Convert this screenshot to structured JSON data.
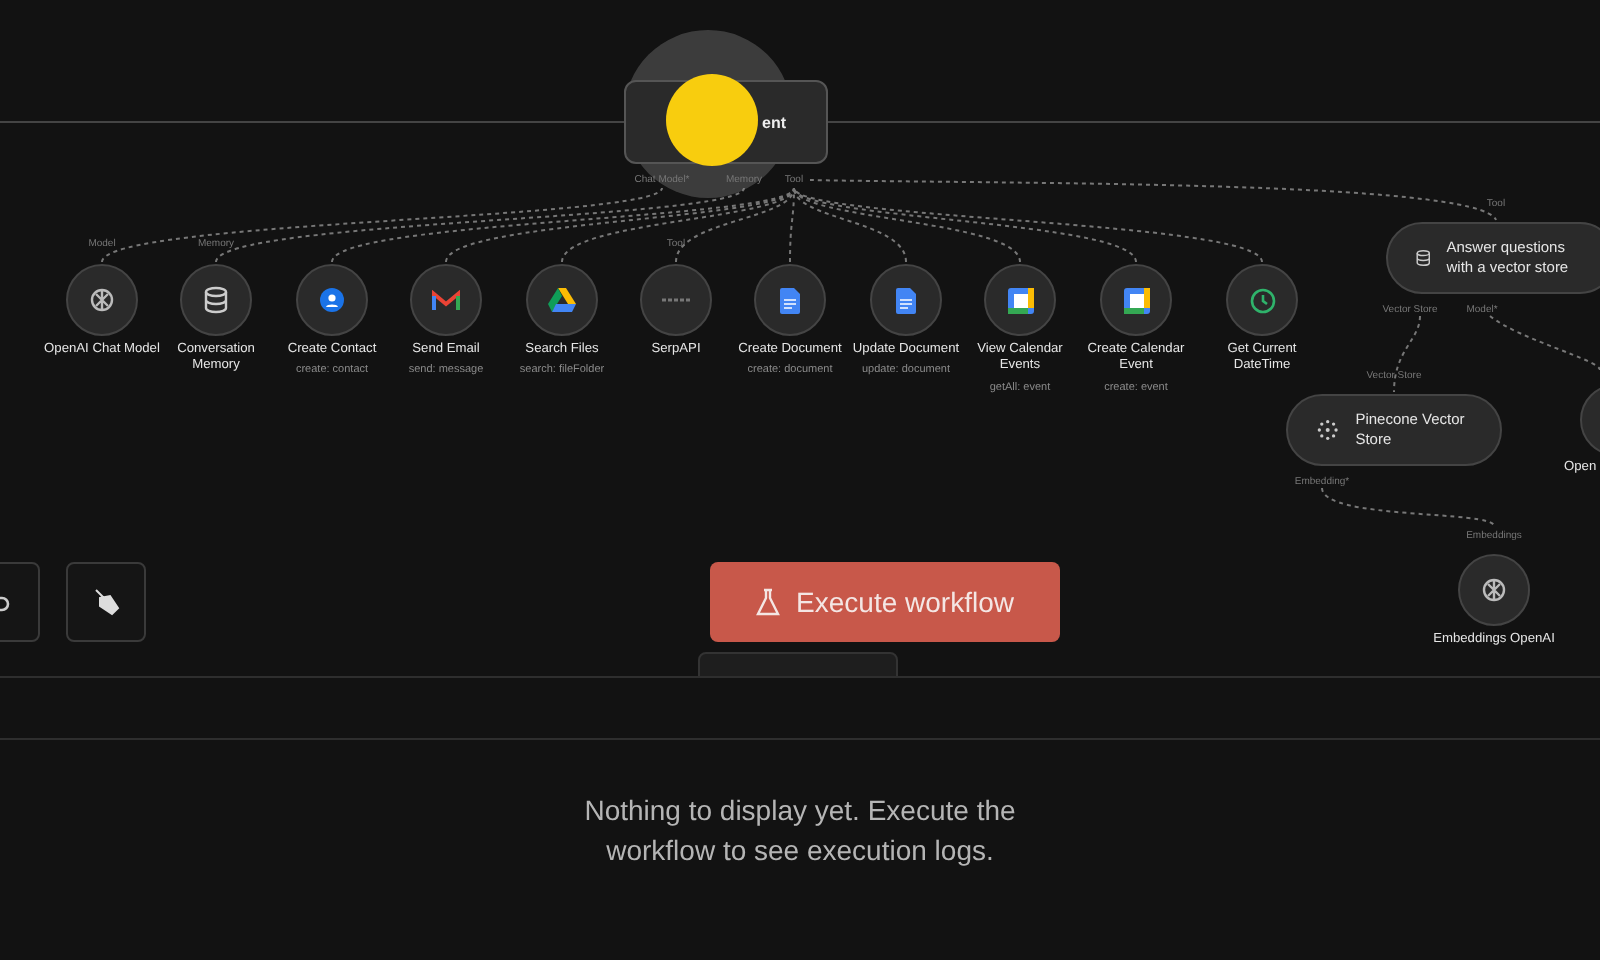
{
  "agent": {
    "title": "ent",
    "inputs": [
      {
        "label": "Chat Model*"
      },
      {
        "label": "Memory"
      },
      {
        "label": "Tool"
      }
    ]
  },
  "sub_nodes": [
    {
      "kind": "openai",
      "label": "OpenAI Chat Model",
      "input": "Model"
    },
    {
      "kind": "database",
      "label": "Conversation Memory",
      "input": "Memory"
    },
    {
      "kind": "contact",
      "label": "Create Contact",
      "subtitle": "create: contact"
    },
    {
      "kind": "gmail",
      "label": "Send Email",
      "subtitle": "send: message"
    },
    {
      "kind": "drive",
      "label": "Search Files",
      "subtitle": "search: fileFolder"
    },
    {
      "kind": "serp",
      "label": "SerpAPI",
      "input": "Tool"
    },
    {
      "kind": "doc",
      "label": "Create Document",
      "subtitle": "create: document"
    },
    {
      "kind": "doc",
      "label": "Update Document",
      "subtitle": "update: document"
    },
    {
      "kind": "calendar",
      "label": "View Calendar Events",
      "subtitle": "getAll: event"
    },
    {
      "kind": "calendar",
      "label": "Create Calendar Event",
      "subtitle": "create: event"
    },
    {
      "kind": "clock",
      "label": "Get Current DateTime"
    }
  ],
  "vector_tool": {
    "input": "Tool",
    "label": "Answer questions with a vector store",
    "outputs": [
      "Vector Store",
      "Model*"
    ]
  },
  "pinecone": {
    "input": "Vector Store",
    "label": "Pinecone Vector Store",
    "output": "Embedding*"
  },
  "embeddings": {
    "input": "Embeddings",
    "label": "Embeddings OpenAI"
  },
  "edge_node": {
    "label": "Open"
  },
  "execute_button": {
    "label": "Execute workflow"
  },
  "logs": {
    "message": "Nothing to display yet. Execute the workflow to see execution logs."
  }
}
